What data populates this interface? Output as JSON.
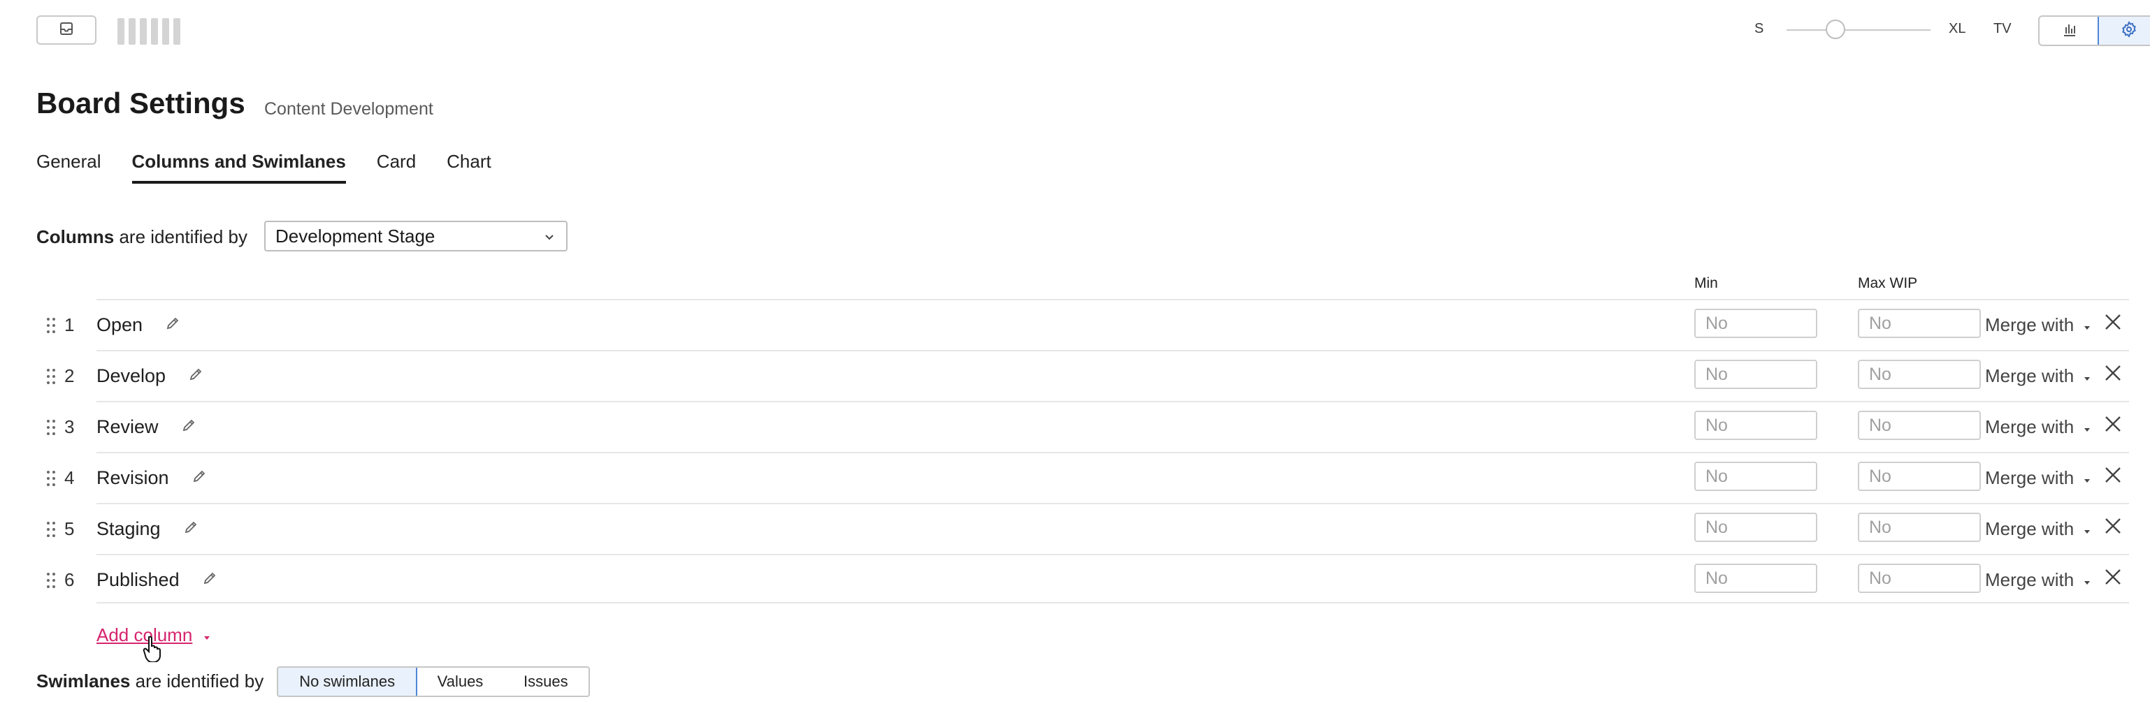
{
  "toolbar": {
    "size_small": "S",
    "size_large": "XL",
    "size_tv": "TV",
    "icons": {
      "inbox": "inbox-icon",
      "chart": "bar-chart-icon",
      "settings": "gear-icon"
    }
  },
  "header": {
    "title": "Board Settings",
    "subtitle": "Content Development"
  },
  "tabs": [
    {
      "label": "General",
      "active": false
    },
    {
      "label": "Columns and Swimlanes",
      "active": true
    },
    {
      "label": "Card",
      "active": false
    },
    {
      "label": "Chart",
      "active": false
    }
  ],
  "columns_config": {
    "label_bold": "Columns",
    "label_rest": " are identified by",
    "selected": "Development Stage",
    "header_min": "Min",
    "header_max": "Max WIP",
    "rows": [
      {
        "num": "1",
        "name": "Open",
        "min_placeholder": "No",
        "max_placeholder": "No",
        "merge": "Merge with"
      },
      {
        "num": "2",
        "name": "Develop",
        "min_placeholder": "No",
        "max_placeholder": "No",
        "merge": "Merge with"
      },
      {
        "num": "3",
        "name": "Review",
        "min_placeholder": "No",
        "max_placeholder": "No",
        "merge": "Merge with"
      },
      {
        "num": "4",
        "name": "Revision",
        "min_placeholder": "No",
        "max_placeholder": "No",
        "merge": "Merge with"
      },
      {
        "num": "5",
        "name": "Staging",
        "min_placeholder": "No",
        "max_placeholder": "No",
        "merge": "Merge with"
      },
      {
        "num": "6",
        "name": "Published",
        "min_placeholder": "No",
        "max_placeholder": "No",
        "merge": "Merge with"
      }
    ],
    "add_column": "Add column"
  },
  "swimlanes": {
    "label_bold": "Swimlanes",
    "label_rest": " are identified by",
    "options": [
      "No swimlanes",
      "Values",
      "Issues"
    ],
    "selected": "No swimlanes"
  },
  "colors": {
    "accent_link": "#d6246e",
    "selected_blue": "#4f87d6"
  }
}
